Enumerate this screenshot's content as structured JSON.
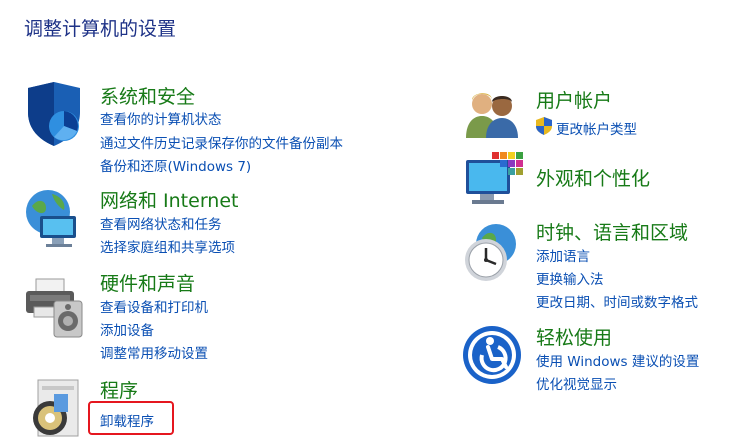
{
  "page": {
    "title": "调整计算机的设置"
  },
  "categories": [
    {
      "id": "system-security",
      "title": "系统和安全",
      "links": [
        "查看你的计算机状态",
        "通过文件历史记录保存你的文件备份副本",
        "备份和还原(Windows 7)"
      ]
    },
    {
      "id": "network-internet",
      "title": "网络和 Internet",
      "links": [
        "查看网络状态和任务",
        "选择家庭组和共享选项"
      ]
    },
    {
      "id": "hardware-sound",
      "title": "硬件和声音",
      "links": [
        "查看设备和打印机",
        "添加设备",
        "调整常用移动设置"
      ]
    },
    {
      "id": "programs",
      "title": "程序",
      "links": [
        "卸载程序"
      ]
    },
    {
      "id": "user-accounts",
      "title": "用户帐户",
      "links": [
        "更改帐户类型"
      ]
    },
    {
      "id": "appearance",
      "title": "外观和个性化",
      "links": []
    },
    {
      "id": "clock-region",
      "title": "时钟、语言和区域",
      "links": [
        "添加语言",
        "更换输入法",
        "更改日期、时间或数字格式"
      ]
    },
    {
      "id": "ease-of-access",
      "title": "轻松使用",
      "links": [
        "使用 Windows 建议的设置",
        "优化视觉显示"
      ]
    }
  ],
  "colors": {
    "title_green": "#177a17",
    "link_blue": "#0a4fb3",
    "header_blue": "#1e3287",
    "highlight_red": "#e5171f"
  },
  "icons": [
    "security-shield-icon",
    "network-globe-icon",
    "printer-hardware-icon",
    "programs-disc-icon",
    "user-accounts-icon",
    "uac-shield-icon",
    "appearance-monitor-icon",
    "clock-globe-icon",
    "ease-of-access-icon"
  ],
  "highlight": "categories.3.links.0"
}
